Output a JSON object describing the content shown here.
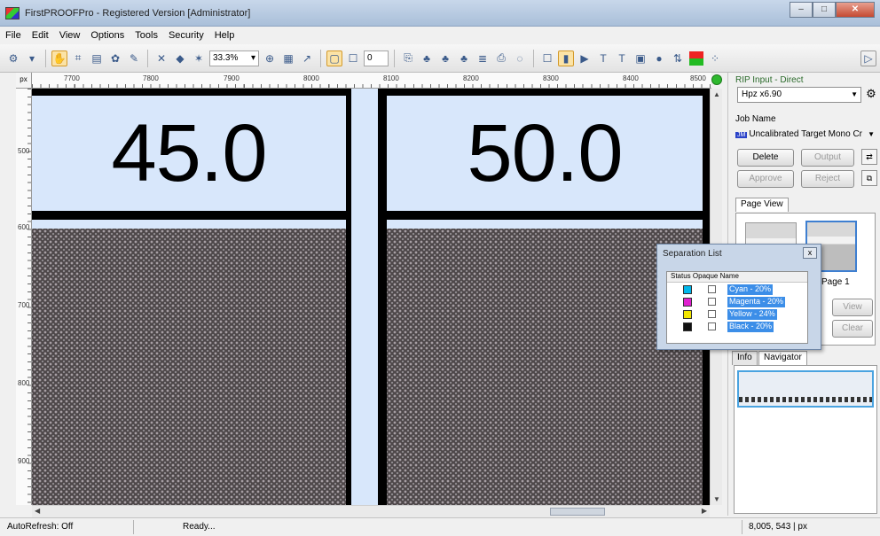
{
  "window": {
    "title": "FirstPROOFPro - Registered Version [Administrator]",
    "min": "–",
    "max": "□",
    "close": "✕"
  },
  "menu": [
    "File",
    "Edit",
    "View",
    "Options",
    "Tools",
    "Security",
    "Help"
  ],
  "toolbar": {
    "zoom": "33.3%",
    "page_number": "0"
  },
  "rulers": {
    "unit": "px",
    "top_labels": [
      "7700",
      "7800",
      "7900",
      "8000",
      "8100",
      "8200",
      "8300",
      "8400",
      "8500"
    ],
    "left_labels": [
      "500",
      "600",
      "700",
      "800",
      "900"
    ]
  },
  "canvas": {
    "left_value": "45.0",
    "right_value": "50.0"
  },
  "sidebar": {
    "rip_input_label": "RIP Input - Direct",
    "rip_device": "Hpz x6.90",
    "job_name_label": "Job Name",
    "job_badge": "JM",
    "job_name": "Uncalibrated Target Mono Cr",
    "buttons": {
      "delete": "Delete",
      "output": "Output",
      "approve": "Approve",
      "reject": "Reject",
      "view": "View",
      "clear": "Clear"
    },
    "page_view_tab": "Page View",
    "page_thumb_label": "Page 1",
    "tabs": {
      "info": "Info",
      "navigator": "Navigator"
    }
  },
  "separation_list": {
    "title": "Separation List",
    "close": "x",
    "columns": "Status  Opaque  Name",
    "rows": [
      {
        "badge": "Cy",
        "color": "#00b7eb",
        "name": "Cyan - 20%"
      },
      {
        "badge": "Mg",
        "color": "#e020d0",
        "name": "Magenta - 20%"
      },
      {
        "badge": "Yw",
        "color": "#f2e600",
        "name": "Yellow - 24%"
      },
      {
        "badge": "Bk",
        "color": "#111111",
        "name": "Black - 20%"
      }
    ]
  },
  "statusbar": {
    "autorefresh": "AutoRefresh: Off",
    "state": "Ready...",
    "coords": "8,005, 543 | px"
  },
  "colors": {
    "header_bg": "#d8e7fb",
    "selection": "#3c8ee8",
    "window_accent": "#a9bfd9"
  }
}
